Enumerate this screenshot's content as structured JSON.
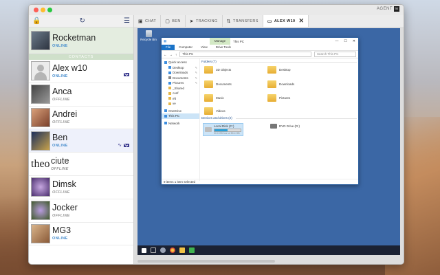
{
  "app": {
    "brand": "AGENT",
    "brand_logo": "io"
  },
  "me": {
    "name": "Rocketman",
    "status": "ONLINE"
  },
  "section": "CONTACTS",
  "contacts": [
    {
      "name": "Alex w10",
      "status": "ONLINE"
    },
    {
      "name": "Anca",
      "status": "OFFLINE"
    },
    {
      "name": "Andrei",
      "status": "OFFLINE"
    },
    {
      "name": "Ben",
      "status": "ONLINE"
    },
    {
      "name": "ciute",
      "status": "OFFLINE",
      "avatar_text": "theo"
    },
    {
      "name": "Dimsk",
      "status": "OFFLINE"
    },
    {
      "name": "Jocker",
      "status": "OFFLINE"
    },
    {
      "name": "MG3",
      "status": "ONLINE"
    }
  ],
  "tabs": [
    {
      "label": "CHAT",
      "icon": "chat-icon"
    },
    {
      "label": "BEN",
      "icon": "folder-icon"
    },
    {
      "label": "TRACKING",
      "icon": "location-icon"
    },
    {
      "label": "TRANSFERS",
      "icon": "transfer-icon"
    },
    {
      "label": "ALEX W10",
      "icon": "screen-icon"
    }
  ],
  "remote": {
    "recycle_bin": "Recycle Bin",
    "explorer": {
      "manage": "Manage",
      "title": "This PC",
      "ribbon": [
        "File",
        "Computer",
        "View",
        "Drive Tools"
      ],
      "address": "This PC",
      "search_placeholder": "Search This PC",
      "nav": [
        "Quick access",
        "Desktop",
        "Downloads",
        "Documents",
        "Pictures",
        "_Shared",
        "conf",
        "eft",
        "ve",
        "OneDrive",
        "This PC",
        "Network"
      ],
      "folders_header": "Folders (7)",
      "folders": [
        "3D Objects",
        "Desktop",
        "Documents",
        "Downloads",
        "Music",
        "Pictures",
        "Videos"
      ],
      "drives_header": "Devices and drives (2)",
      "drives": [
        {
          "name": "Local Disk (C:)",
          "free": "30.0 GB free of 59.4 GB",
          "used_fraction": 0.5
        },
        {
          "name": "DVD Drive (D:)"
        }
      ],
      "status": "9 items    1 item selected"
    }
  },
  "colors": {
    "online": "#4a8fce",
    "accent": "#2f3f6f",
    "desktop": "#3b67a5"
  }
}
